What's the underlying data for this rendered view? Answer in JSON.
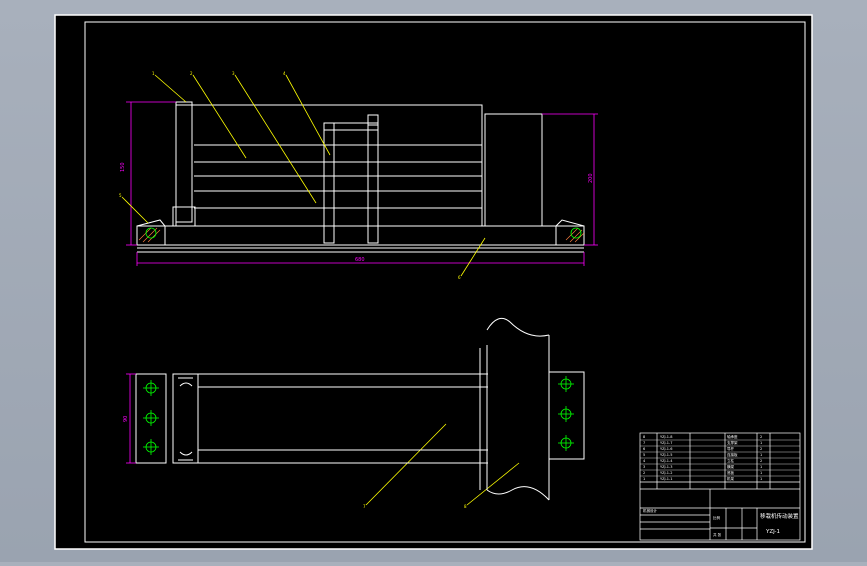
{
  "drawing": {
    "title_block": {
      "drawing_title": "移栽机传动装置",
      "drawing_number": "YZJ-1",
      "material_row": "机械设计",
      "scale_label": "比例",
      "sheet_label": "共  张"
    },
    "dimensions": {
      "front_height": "150",
      "front_width": "680",
      "right_height": "200",
      "plan_height": "90"
    },
    "balloons": [
      "1",
      "2",
      "3",
      "4",
      "5",
      "6",
      "7",
      "8"
    ],
    "bom_rows": [
      {
        "no": "8",
        "code": "YZJ-1-8",
        "name": "轴承座",
        "qty": "2"
      },
      {
        "no": "7",
        "code": "YZJ-1-7",
        "name": "支撑架",
        "qty": "1"
      },
      {
        "no": "6",
        "code": "YZJ-1-6",
        "name": "导杆",
        "qty": "2"
      },
      {
        "no": "5",
        "code": "YZJ-1-5",
        "name": "连接板",
        "qty": "1"
      },
      {
        "no": "4",
        "code": "YZJ-1-4",
        "name": "立柱",
        "qty": "2"
      },
      {
        "no": "3",
        "code": "YZJ-1-3",
        "name": "横梁",
        "qty": "1"
      },
      {
        "no": "2",
        "code": "YZJ-1-2",
        "name": "底板",
        "qty": "1"
      },
      {
        "no": "1",
        "code": "YZJ-1-1",
        "name": "机架",
        "qty": "1"
      }
    ],
    "colors": {
      "background": "#000000",
      "outline": "#ffffff",
      "leader": "#ffff00",
      "dimension": "#ff00ff",
      "centerline": "#00ff00",
      "hatch": "#ff8040"
    }
  }
}
